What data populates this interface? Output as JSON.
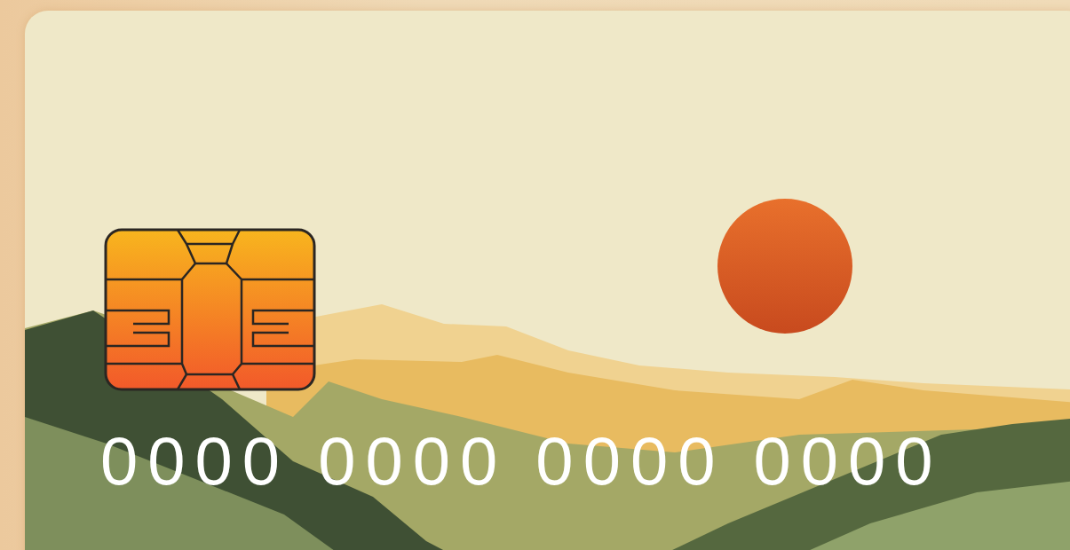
{
  "card": {
    "number": "0000 0000 0000 0000"
  }
}
